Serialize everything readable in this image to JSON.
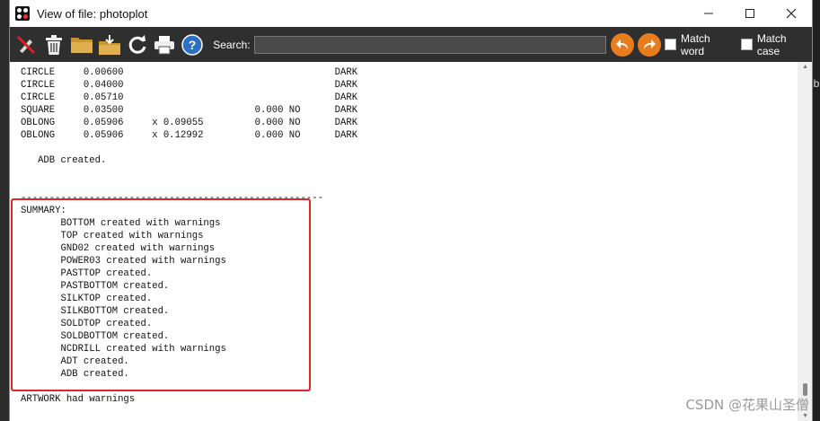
{
  "window": {
    "title": "View of file: photoplot"
  },
  "toolbar": {
    "search_label": "Search:",
    "search_value": "",
    "match_word_label": "Match word",
    "match_case_label": "Match case"
  },
  "report_lines": [
    "CIRCLE     0.00600                                     DARK",
    "CIRCLE     0.04000                                     DARK",
    "CIRCLE     0.05710                                     DARK",
    "SQUARE     0.03500                       0.000 NO      DARK",
    "OBLONG     0.05906     x 0.09055         0.000 NO      DARK",
    "OBLONG     0.05906     x 0.12992         0.000 NO      DARK",
    "",
    "   ADB created.",
    "",
    "",
    "-----------------------------------------------------",
    "SUMMARY:",
    "       BOTTOM created with warnings",
    "       TOP created with warnings",
    "       GND02 created with warnings",
    "       POWER03 created with warnings",
    "       PASTTOP created.",
    "       PASTBOTTOM created.",
    "       SILKTOP created.",
    "       SILKBOTTOM created.",
    "       SOLDTOP created.",
    "       SOLDBOTTOM created.",
    "       NCDRILL created with warnings",
    "       ADT created.",
    "       ADB created.",
    "",
    "ARTWORK had warnings"
  ],
  "watermark": "CSDN @花果山圣僧",
  "background_right_glyph": "b",
  "colors": {
    "toolbar_bg": "#2f2f2f",
    "nav_orange": "#e87d1e",
    "highlight_red": "#e0252c"
  }
}
